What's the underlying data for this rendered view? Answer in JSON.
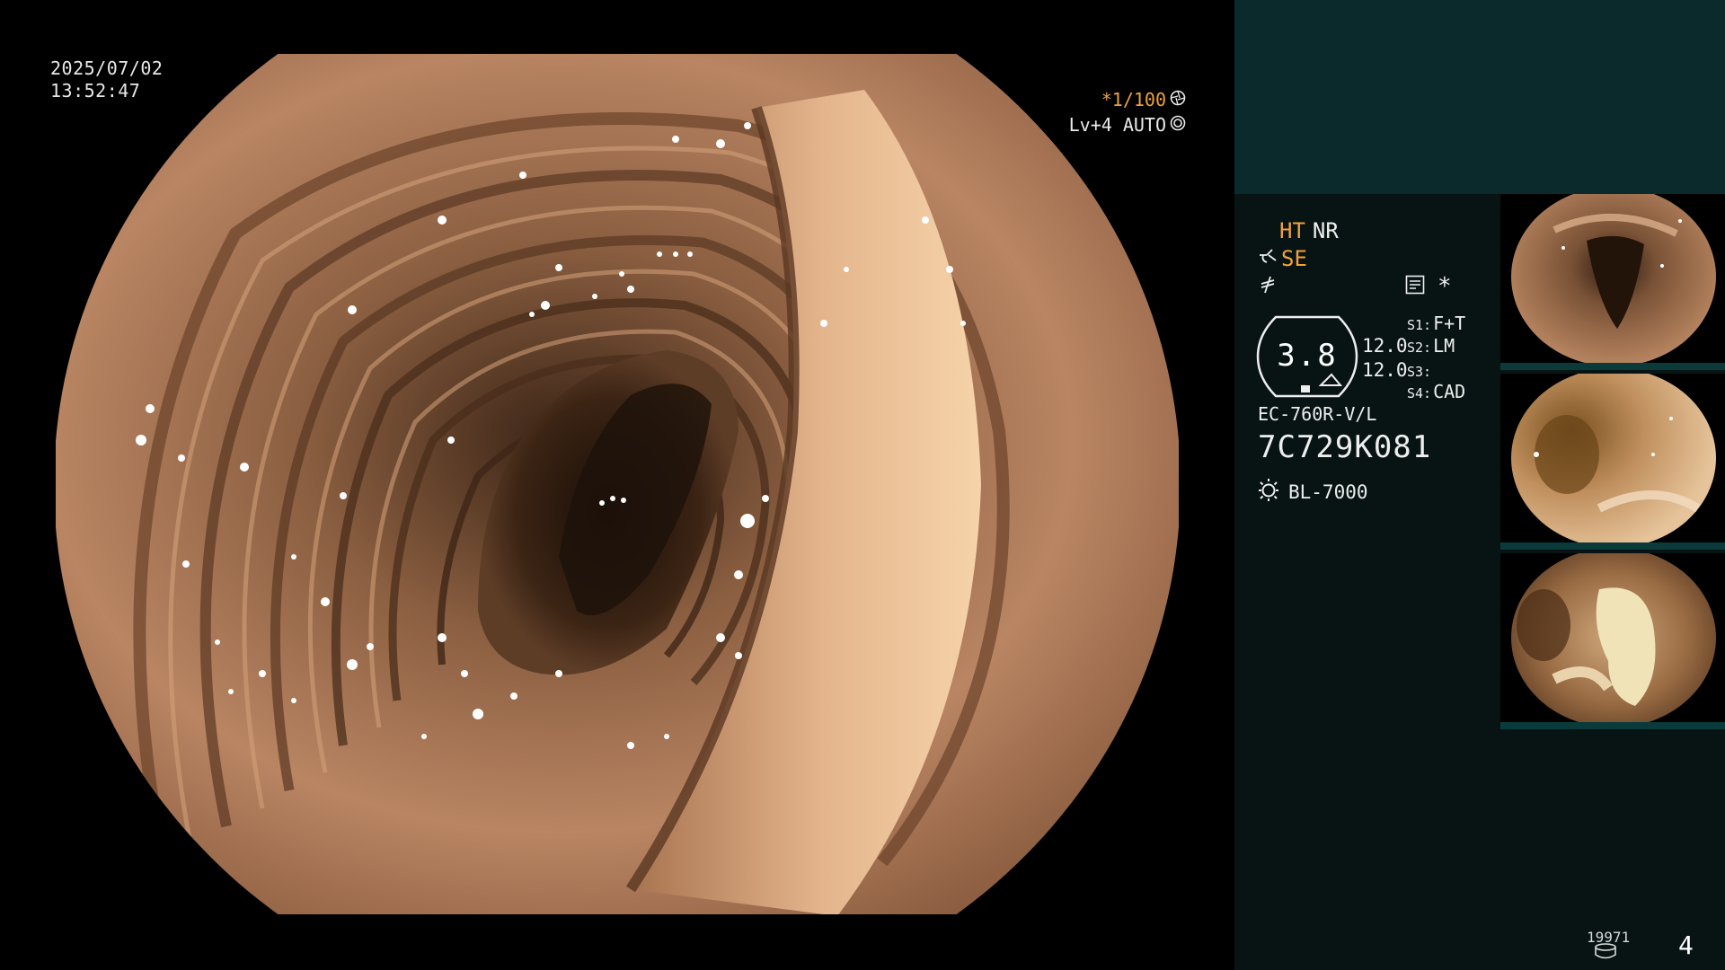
{
  "overlay": {
    "date": "2025/07/02",
    "time": "13:52:47",
    "shutter": "*1/100",
    "level": "Lv+4 AUTO",
    "shutter_icon": "aperture-icon",
    "level_icon": "ring-icon"
  },
  "panel": {
    "ht": "HT",
    "nr": "NR",
    "se": "SE",
    "star": "*",
    "gauge_value": "3.8",
    "val_a": "12.0",
    "val_b": "12.0",
    "switches": [
      {
        "key": "S1:",
        "val": "F+T"
      },
      {
        "key": "S2:",
        "val": "LM"
      },
      {
        "key": "S3:",
        "val": ""
      },
      {
        "key": "S4:",
        "val": "CAD"
      }
    ],
    "scope_model": "EC-760R-V/L",
    "scope_serial": "7C729K081",
    "light_source": "BL-7000",
    "colors": {
      "amber": "#f0a23a",
      "panel_top": "#0a2a2b",
      "panel_body": "#081414"
    }
  },
  "footer": {
    "counter": "19971",
    "page": "4"
  }
}
